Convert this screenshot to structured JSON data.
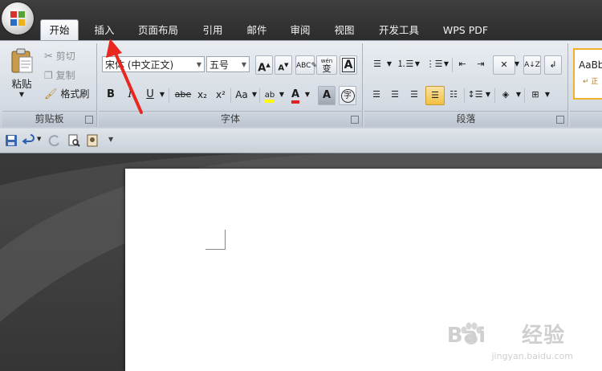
{
  "tabs": [
    {
      "label": "开始",
      "active": true
    },
    {
      "label": "插入"
    },
    {
      "label": "页面布局"
    },
    {
      "label": "引用"
    },
    {
      "label": "邮件"
    },
    {
      "label": "审阅"
    },
    {
      "label": "视图"
    },
    {
      "label": "开发工具"
    },
    {
      "label": "WPS PDF"
    }
  ],
  "clipboard": {
    "paste": "粘贴",
    "cut": "剪切",
    "copy": "复制",
    "format_painter": "格式刷",
    "group_label": "剪贴板"
  },
  "font": {
    "font_name": "宋体 (中文正文)",
    "font_size": "五号",
    "group_label": "字体",
    "bold": "B",
    "italic": "I",
    "underline": "U",
    "strike": "abe",
    "subscript": "x₂",
    "superscript": "x²",
    "change_case": "Aa",
    "grow": "A",
    "shrink": "A",
    "char_border": "A",
    "char_shade": "A",
    "enclose": "字",
    "phonetic": "wén",
    "phonetic_char": "变",
    "highlight_color": "#ffff00",
    "font_color": "#e02020"
  },
  "paragraph": {
    "group_label": "段落",
    "shading_color": "#f0c040"
  },
  "styles": {
    "preview": "AaBb",
    "preview_sub": "↵ 正"
  },
  "watermark": {
    "brand": "Bai",
    "brand2": "经验",
    "site": "jingyan.baidu.com"
  },
  "colors": {
    "annotation_arrow": "#e8281e",
    "office_logo_red": "#d9322c",
    "office_logo_green": "#5aa332",
    "office_logo_blue": "#2b6cc4",
    "office_logo_yellow": "#f0b21b"
  }
}
